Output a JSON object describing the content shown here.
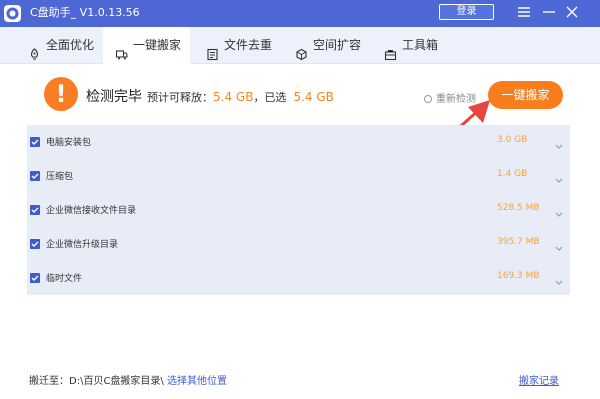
{
  "titlebar": {
    "title": "C盘助手_ V1.0.13.56",
    "login_label": "登录"
  },
  "tabs": [
    {
      "label": "全面优化",
      "icon": "rocket-icon"
    },
    {
      "label": "一键搬家",
      "icon": "move-icon"
    },
    {
      "label": "文件去重",
      "icon": "file-icon"
    },
    {
      "label": "空间扩容",
      "icon": "expand-icon"
    },
    {
      "label": "工具箱",
      "icon": "toolbox-icon"
    }
  ],
  "active_tab": "一键搬家",
  "status": {
    "title": "检测完毕",
    "releasable_label": "预计可释放：",
    "releasable_value": "5.4 GB",
    "selected_label": "，已选",
    "selected_value": "5.4 GB",
    "recheck_label": "重新检测",
    "move_button_label": "一键搬家"
  },
  "items": [
    {
      "label": "电脑安装包",
      "size": "3.0 GB",
      "checked": true
    },
    {
      "label": "压缩包",
      "size": "1.4 GB",
      "checked": true
    },
    {
      "label": "企业微信接收文件目录",
      "size": "528.5 MB",
      "checked": true
    },
    {
      "label": "企业微信升级目录",
      "size": "395.7 MB",
      "checked": true
    },
    {
      "label": "临时文件",
      "size": "169.3 MB",
      "checked": true
    }
  ],
  "footer": {
    "path_label": "搬迁至：",
    "path_value": "D:\\百贝C盘搬家目录\\",
    "choose_label": "选择其他位置",
    "history_label": "搬家记录"
  },
  "colors": {
    "titlebar": "#4d67d4",
    "accent_orange": "#f97d1c",
    "checkbox_blue": "#3e5ccc",
    "list_bg": "#e8ecf7"
  }
}
